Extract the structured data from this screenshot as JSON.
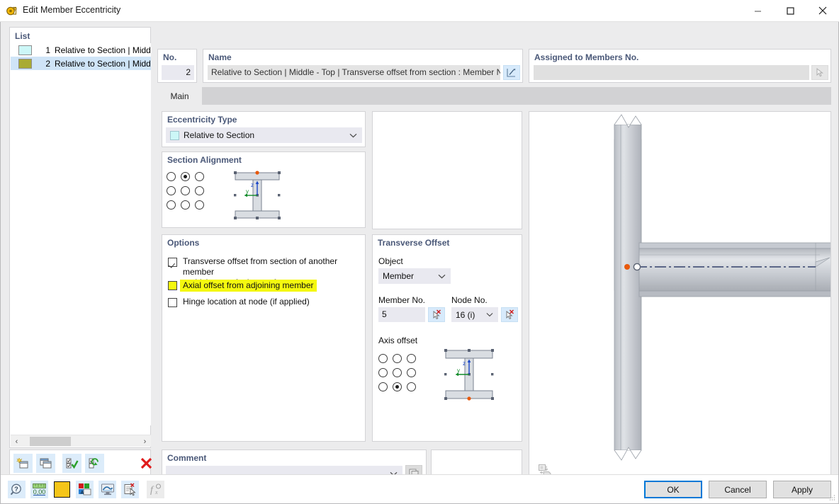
{
  "window": {
    "title": "Edit Member Eccentricity",
    "icon": "eccentricity-icon",
    "minimize_label": "—",
    "maximize_label": "□",
    "close_label": "✕"
  },
  "list_panel": {
    "header": "List",
    "rows": [
      {
        "no": "1",
        "label": "Relative to Section | Middle - To",
        "color": "#ccf7f7",
        "selected": false
      },
      {
        "no": "2",
        "label": "Relative to Section | Middle - To",
        "color": "#a9ab33",
        "selected": true
      }
    ],
    "scroll_left_icon": "‹",
    "scroll_right_icon": "›",
    "toolbar": [
      {
        "name": "new-eccentricity-button",
        "icon": "new-window-icon"
      },
      {
        "name": "copy-eccentricity-button",
        "icon": "copy-window-icon"
      },
      {
        "name": "select-all-button",
        "icon": "check-list-icon"
      },
      {
        "name": "invert-selection-button",
        "icon": "refresh-list-icon"
      },
      {
        "name": "delete-eccentricity-button",
        "icon": "red-x-icon"
      }
    ]
  },
  "no_group": {
    "header": "No.",
    "value": "2"
  },
  "name_group": {
    "header": "Name",
    "value": "Relative to Section | Middle - Top | Transverse offset from section : Member No",
    "edit_icon": "pencil-edit-icon"
  },
  "assigned_group": {
    "header": "Assigned to Members No.",
    "value": "",
    "placeholder": "",
    "pick_icon": "select-cursor-icon"
  },
  "tabs": [
    {
      "label": "Main",
      "active": true
    }
  ],
  "eccentricity_type": {
    "header": "Eccentricity Type",
    "value": "Relative to Section",
    "swatch_color": "#ccf7f7",
    "chevron": "⌄"
  },
  "section_alignment": {
    "header": "Section Alignment",
    "grid": [
      [
        false,
        true,
        false
      ],
      [
        false,
        false,
        false
      ],
      [
        false,
        false,
        false
      ]
    ],
    "diagram": {
      "name": "i-beam-section-diagram",
      "z_axis_label": "z",
      "y_axis_label": "y",
      "marker_position": "top-middle",
      "marker_color": "#e8590c"
    }
  },
  "options": {
    "header": "Options",
    "items": [
      {
        "label_line1": "Transverse offset from section of another member",
        "label_line2": "or thickness of other surface",
        "checked": true,
        "highlighted": false,
        "name": "option-transverse-offset"
      },
      {
        "label_line1": "Axial offset from adjoining member",
        "label_line2": "",
        "checked": false,
        "highlighted": true,
        "name": "option-axial-offset"
      },
      {
        "label_line1": "Hinge location at node (if applied)",
        "label_line2": "",
        "checked": false,
        "highlighted": false,
        "name": "option-hinge-location"
      }
    ]
  },
  "transverse_offset": {
    "header": "Transverse Offset",
    "object_label": "Object",
    "object_value": "Member",
    "object_chevron": "⌄",
    "member_no_label": "Member No.",
    "member_no_value": "5",
    "member_pick_icon": "select-cursor-icon",
    "node_no_label": "Node No.",
    "node_no_value": "16 (i)",
    "node_chevron": "⌄",
    "node_pick_icon": "select-cursor-icon",
    "axis_offset_label": "Axis offset",
    "grid": [
      [
        false,
        false,
        false
      ],
      [
        false,
        false,
        false
      ],
      [
        false,
        true,
        false
      ]
    ],
    "diagram": {
      "name": "i-beam-axis-offset-diagram",
      "z_axis_label": "z",
      "y_axis_label": "y",
      "marker_position": "bottom-middle",
      "marker_color": "#e8590c"
    }
  },
  "comment": {
    "header": "Comment",
    "value": "",
    "chevron": "⌄",
    "pick_icon": "copy-comment-icon"
  },
  "preview": {
    "name": "member-eccentricity-3d-preview",
    "toggle_icon": "display-properties-icon"
  },
  "bottom_toolbar": [
    {
      "name": "help-button",
      "icon": "help-magnifier-icon",
      "disabled": false
    },
    {
      "name": "units-button",
      "icon": "units-000-icon",
      "disabled": false
    },
    {
      "name": "color-button",
      "icon": "yellow-color-swatch-icon",
      "disabled": false
    },
    {
      "name": "display-properties-button",
      "icon": "display-properties-icon",
      "disabled": false
    },
    {
      "name": "view-mode-button",
      "icon": "screen-icon",
      "disabled": false
    },
    {
      "name": "info-button",
      "icon": "document-cursor-icon",
      "disabled": false
    },
    {
      "name": "function-button",
      "icon": "fx-icon",
      "disabled": true
    }
  ],
  "dialog_buttons": [
    {
      "label": "OK",
      "name": "ok-button",
      "default": true
    },
    {
      "label": "Cancel",
      "name": "cancel-button",
      "default": false
    },
    {
      "label": "Apply",
      "name": "apply-button",
      "default": false
    }
  ]
}
